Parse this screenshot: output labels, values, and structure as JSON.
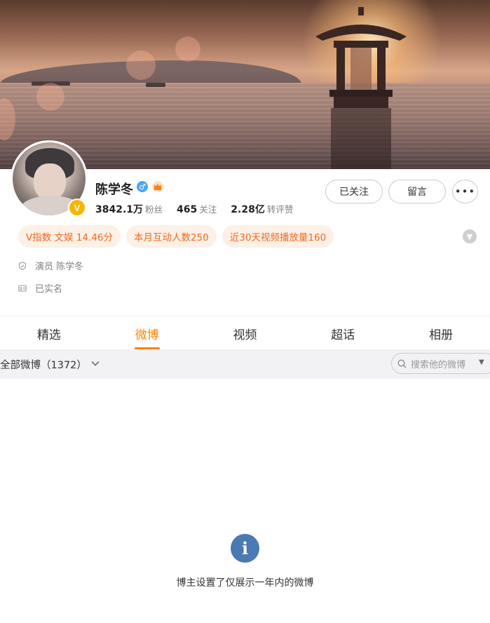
{
  "profile": {
    "name": "陈学冬",
    "gender_symbol": "♂",
    "badge_letter": "V",
    "stats": [
      {
        "num": "3842.1万",
        "label": "粉丝"
      },
      {
        "num": "465",
        "label": "关注"
      },
      {
        "num": "2.28亿",
        "label": "转评赞"
      }
    ]
  },
  "actions": {
    "follow_label": "已关注",
    "message_label": "留言",
    "more_label": "•••"
  },
  "tags": [
    "V指数 文娱 14.46分",
    "本月互动人数250",
    "近30天视频播放量160"
  ],
  "info": [
    {
      "icon": "shield-icon",
      "text": "演员 陈学冬"
    },
    {
      "icon": "id-card-icon",
      "text": "已实名"
    }
  ],
  "tabs": [
    "精选",
    "微博",
    "视频",
    "超话",
    "相册"
  ],
  "active_tab": "微博",
  "filter": {
    "label": "全部微博（1372）",
    "search_placeholder": "搜索他的微博"
  },
  "notice": {
    "icon_glyph": "i",
    "text": "博主设置了仅展示一年内的微博"
  },
  "colors": {
    "accent": "#ff8200",
    "tag_text": "#ee6a22",
    "tag_bg": "#fdf0e6",
    "verified": "#f7b500",
    "info_icon": "#4a79b4"
  }
}
